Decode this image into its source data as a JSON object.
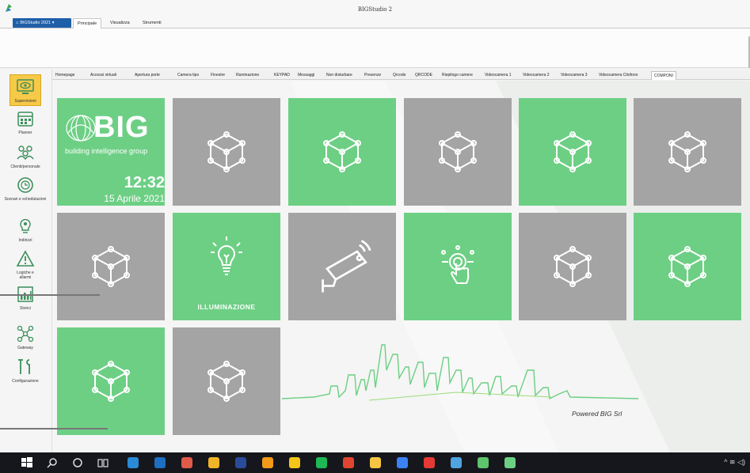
{
  "window": {
    "title": "BIGStudio 2"
  },
  "ribbon": {
    "app_menu_label": "BIGStudio 2021",
    "tabs": [
      "Principale",
      "Visualizza",
      "Strumenti"
    ],
    "active_tab": "Principale"
  },
  "sidebar": {
    "items": [
      {
        "label": "Supervisioni",
        "icon": "monitor-eye-icon",
        "active": true
      },
      {
        "label": "Planner",
        "icon": "calendar-icon"
      },
      {
        "label": "Clienti/personale",
        "icon": "people-icon"
      },
      {
        "label": "Scenari e schedulazioni",
        "icon": "schedule-clock-icon"
      },
      {
        "label": "Indirizzi",
        "icon": "bulb-gear-icon"
      },
      {
        "label": "Logiche e allarmi",
        "icon": "warning-triangle-icon"
      },
      {
        "label": "Storici",
        "icon": "history-chart-icon"
      },
      {
        "label": "Gateway",
        "icon": "network-nodes-icon"
      },
      {
        "label": "Configurazione",
        "icon": "tools-icon"
      }
    ]
  },
  "content_tabs": {
    "items": [
      "Homepage",
      "Accessi virtuali",
      "Apertura porte",
      "Camera tipo",
      "Finestre",
      "Illuminazione",
      "KEYPAD",
      "Messaggi",
      "Non disturbare",
      "Presenze",
      "Qrcode",
      "QRCODE",
      "Riepilogo camere",
      "Videocamera 1",
      "Videocamera 2",
      "Videocamera 3",
      "Videocamera Citofono",
      "COMPONI"
    ],
    "active": "COMPONI"
  },
  "logo_tile": {
    "brand": "BIG",
    "tagline": "building intelligence group",
    "time": "12:32",
    "date": "15 Aprile 2021"
  },
  "tiles": [
    {
      "color": "grey",
      "icon": "cube-icon"
    },
    {
      "color": "green",
      "icon": "cube-icon"
    },
    {
      "color": "grey",
      "icon": "cube-icon"
    },
    {
      "color": "green",
      "icon": "cube-icon"
    },
    {
      "color": "grey",
      "icon": "cube-icon"
    },
    {
      "color": "grey",
      "icon": "cube-icon"
    },
    {
      "color": "green",
      "icon": "lightbulb-icon",
      "label": "ILLUMINAZIONE"
    },
    {
      "color": "grey",
      "icon": "cctv-camera-icon"
    },
    {
      "color": "green",
      "icon": "touch-control-icon"
    },
    {
      "color": "grey",
      "icon": "cube-icon"
    },
    {
      "color": "green",
      "icon": "cube-icon"
    },
    {
      "color": "green",
      "icon": "cube-icon"
    },
    {
      "color": "grey",
      "icon": "cube-icon"
    }
  ],
  "footer_brand": "Powered BIG Srl",
  "colors": {
    "tile_green": "#6dcf84",
    "tile_grey": "#a4a4a4",
    "accent_blue": "#1f5fa8",
    "active_side": "#f7c948"
  },
  "taskbar": {
    "icons": [
      "windows-start-icon",
      "search-icon",
      "cortana-circle-icon",
      "task-view-icon",
      "calculator-icon",
      "outlook-icon",
      "paint-icon",
      "chrome-icon",
      "photoshop-icon",
      "app-orange-icon",
      "app-yellow-icon",
      "spotify-icon",
      "app-red-icon",
      "file-explorer-icon",
      "app-blue-icon",
      "app-badge-icon",
      "photos-icon",
      "bigstudio-icon",
      "bigstudio-active-icon"
    ]
  }
}
